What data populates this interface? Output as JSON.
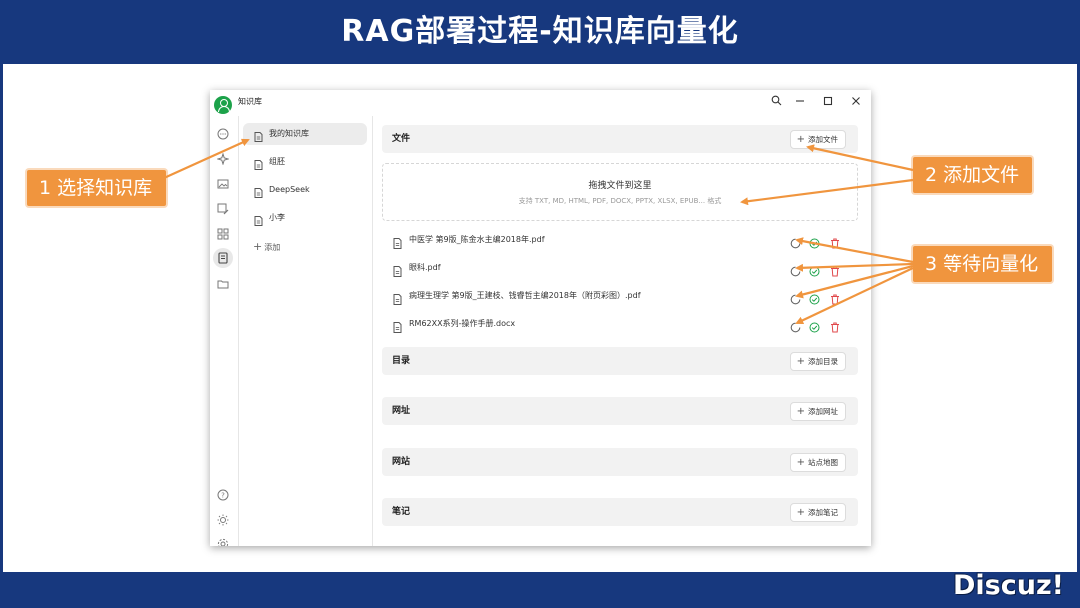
{
  "slide": {
    "title": "RAG部署过程-知识库向量化",
    "watermark": "Discuz!",
    "colors": {
      "frame": "#17387e",
      "callout": "#f0953e",
      "accent_green": "#1ca24a",
      "delete_red": "#e0484b"
    }
  },
  "app": {
    "title": "知识库",
    "window_controls": {
      "search": "⌕",
      "minimize": "–",
      "maximize": "▢",
      "close": "✕"
    },
    "rail_icons": [
      "chat-icon",
      "sparkle-icon",
      "image-icon",
      "image-edit-icon",
      "grid-icon",
      "knowledge-icon",
      "folder-icon",
      "help-icon",
      "sun-icon",
      "settings-icon"
    ],
    "knowledge_bases": [
      {
        "label": "我的知识库",
        "selected": true
      },
      {
        "label": "组胚",
        "selected": false
      },
      {
        "label": "DeepSeek",
        "selected": false
      },
      {
        "label": "小李",
        "selected": false
      }
    ],
    "add_kb_label": "添加"
  },
  "sections": {
    "files": {
      "title": "文件",
      "button": "添加文件"
    },
    "dropzone": {
      "title": "拖拽文件到这里",
      "hint": "支持 TXT, MD, HTML, PDF, DOCX, PPTX, XLSX, EPUB... 格式"
    },
    "file_list": [
      {
        "name": "中医学 第9版_陈金水主编2018年.pdf"
      },
      {
        "name": "眼科.pdf"
      },
      {
        "name": "病理生理学 第9版_王建枝、钱睿哲主编2018年（附页彩图）.pdf"
      },
      {
        "name": "RM62XX系列-操作手册.docx"
      }
    ],
    "directory": {
      "title": "目录",
      "button": "添加目录"
    },
    "url": {
      "title": "网址",
      "button": "添加网址"
    },
    "website": {
      "title": "网站",
      "button": "站点地图"
    },
    "notes": {
      "title": "笔记",
      "button": "添加笔记"
    }
  },
  "callouts": {
    "step1": "1 选择知识库",
    "step2": "2 添加文件",
    "step3": "3 等待向量化"
  }
}
